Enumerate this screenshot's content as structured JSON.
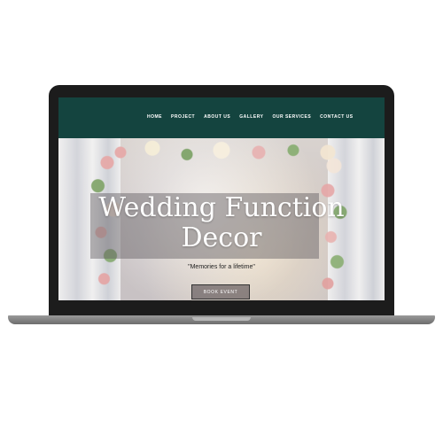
{
  "nav": {
    "items": [
      {
        "label": "HOME"
      },
      {
        "label": "PROJECT"
      },
      {
        "label": "ABOUT US"
      },
      {
        "label": "GALLERY"
      },
      {
        "label": "OUR SERVICES"
      },
      {
        "label": "CONTACT US"
      }
    ]
  },
  "hero": {
    "title_line1": "Wedding Function",
    "title_line2": "Decor",
    "tagline": "\"Memories for a lifetime\"",
    "cta_label": "BOOK EVENT"
  },
  "colors": {
    "nav_background": "#14443f",
    "laptop_bezel": "#1c1c1c"
  }
}
